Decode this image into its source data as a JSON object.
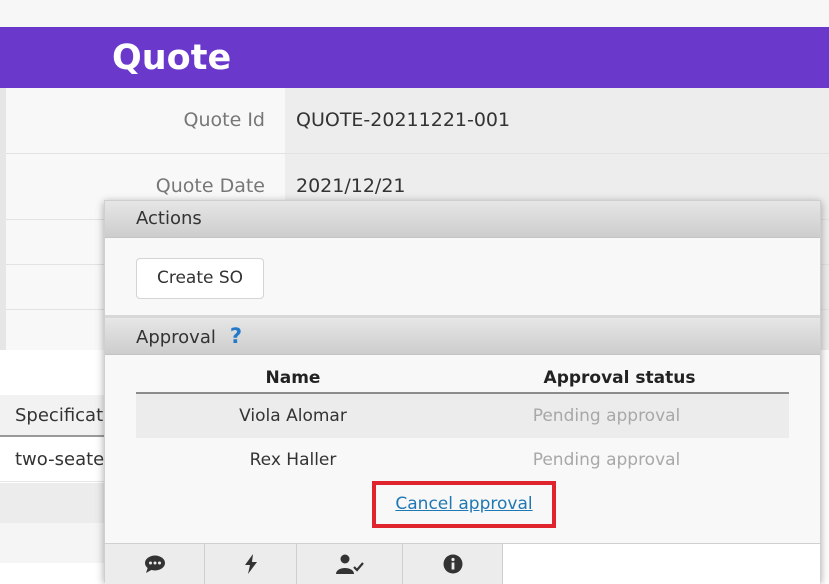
{
  "header": {
    "title": "Quote"
  },
  "form": {
    "quote_id_label": "Quote Id",
    "quote_id_value": "QUOTE-20211221-001",
    "quote_date_label": "Quote Date",
    "quote_date_value": "2021/12/21"
  },
  "table": {
    "column_header": "Specificat",
    "cell_value": "two-seate"
  },
  "popup": {
    "actions_header": "Actions",
    "create_so_label": "Create SO",
    "approval_header": "Approval",
    "help_icon": "?",
    "approval_table": {
      "headers": [
        "Name",
        "Approval status"
      ],
      "rows": [
        {
          "name": "Viola Alomar",
          "status": "Pending approval"
        },
        {
          "name": "Rex Haller",
          "status": "Pending approval"
        }
      ]
    },
    "cancel_link": "Cancel approval",
    "tabs": [
      "comment-icon",
      "lightning-icon",
      "user-check-icon",
      "info-icon"
    ]
  },
  "colors": {
    "header_bg": "#6a38cb",
    "highlight_border": "#e0242e",
    "link": "#1f78b4",
    "help_icon": "#2479c9"
  }
}
